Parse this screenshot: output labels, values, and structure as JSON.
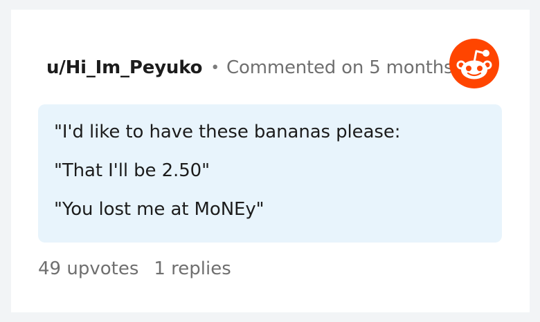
{
  "comment": {
    "username": "u/Hi_Im_Peyuko",
    "separator": "•",
    "timestamp": "Commented on 5 months ago",
    "lines": [
      "\"I'd like to have these bananas please:",
      "\"That I'll be 2.50\"",
      "\"You lost me at MoNEy\""
    ],
    "upvotes": "49 upvotes",
    "replies": "1 replies"
  },
  "logo": {
    "icon": "reddit-snoo-icon",
    "color": "#ff4500"
  },
  "colors": {
    "comment_bg": "#e8f4fc",
    "text": "#1c1c1c",
    "muted": "#6f6f6f"
  }
}
